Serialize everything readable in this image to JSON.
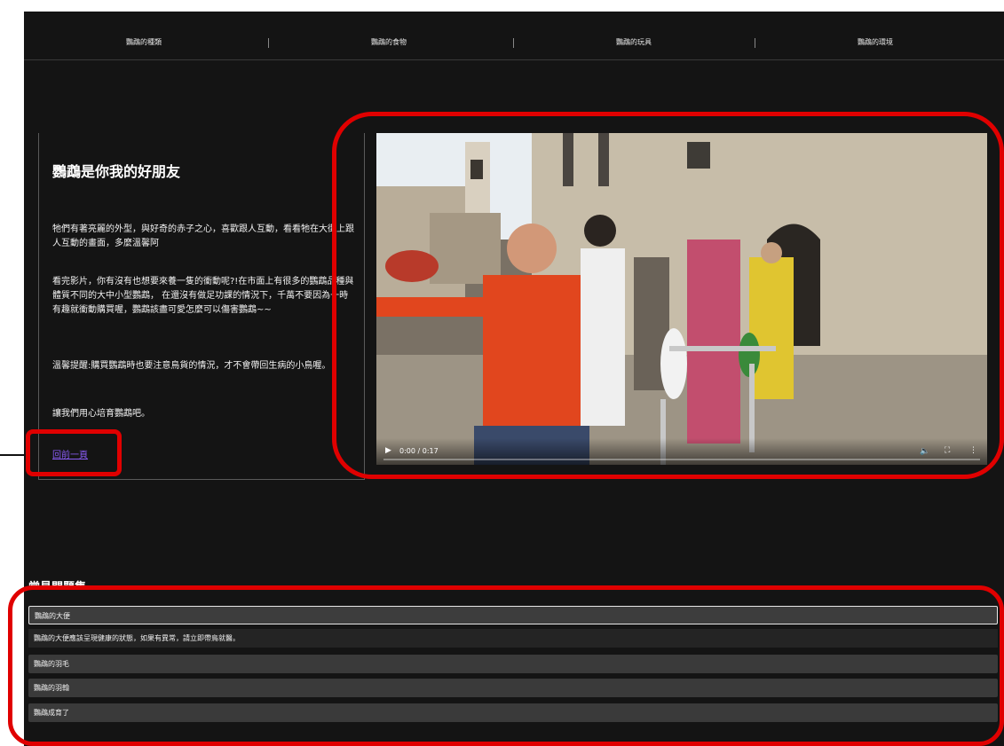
{
  "nav": {
    "items": [
      {
        "label": "鸚鵡的種類"
      },
      {
        "label": "鸚鵡的食物"
      },
      {
        "label": "鸚鵡的玩具"
      },
      {
        "label": "鸚鵡的環境"
      }
    ]
  },
  "intro": {
    "title": "鸚鵡是你我的好朋友",
    "paragraphs": [
      "牠們有著亮麗的外型，與好奇的赤子之心，喜歡跟人互動，看看牠在大街上跟人互動的畫面，多麼溫馨阿",
      "看完影片，你有沒有也想要來養一隻的衝動呢?!在市面上有很多的鸚鵡品種與體質不同的大中小型鸚鵡， 在還沒有做足功課的情況下，千萬不要因為一時有趣就衝動購買喔，鸚鵡該盡可愛怎麼可以傷害鸚鵡~~",
      "溫馨提醒:購買鸚鵡時也要注意鳥貨的情況，才不會帶回生病的小鳥喔。",
      "讓我們用心培育鸚鵡吧。"
    ],
    "back_link": "回前一頁"
  },
  "video": {
    "time": "0:00 / 0:17",
    "play_icon": "play-icon",
    "volume_icon": "volume-icon",
    "fullscreen_icon": "fullscreen-icon",
    "more_icon": "more-vertical-icon"
  },
  "faq": {
    "heading": "常見問題集",
    "items": [
      {
        "label": "鸚鵡的大便"
      },
      {
        "label": "鸚鵡的羽毛"
      },
      {
        "label": "鸚鵡的羽翰"
      },
      {
        "label": "鸚鵡成育了"
      }
    ],
    "answer": "鸚鵡的大便應該呈現健康的狀態，如果有異常，請立即帶鳥就醫。"
  },
  "colors": {
    "background": "#141414",
    "link": "#8a5cf5",
    "annotation": "#e00000"
  }
}
